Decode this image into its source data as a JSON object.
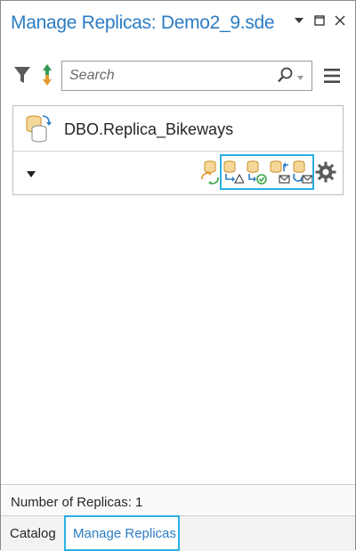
{
  "pane": {
    "title": "Manage Replicas: Demo2_9.sde",
    "controls": [
      "dropdown-arrow-icon",
      "restore-icon",
      "close-icon"
    ]
  },
  "toolbar": {
    "filter_icon": "filter-icon",
    "sort_icon": "sort-icon",
    "search_placeholder": "Search",
    "search_icon": "search-icon",
    "menu_icon": "menu-icon"
  },
  "replica": {
    "name": "DBO.Replica_Bikeways",
    "icon": "replica-icon",
    "actions": [
      "synchronize-changes-icon",
      "export-data-changes-icon",
      "import-message-icon",
      "re-export-unacknowledged-messages-icon",
      "export-acknowledgment-message-icon"
    ],
    "settings_icon": "gear-icon"
  },
  "status": {
    "text": "Number of Replicas: 1"
  },
  "tabs": [
    {
      "label": "Catalog",
      "active": false
    },
    {
      "label": "Manage Replicas",
      "active": true
    }
  ],
  "colors": {
    "title": "#2b7cc4",
    "highlight": "#2bb0e3",
    "database": "#e8b04a",
    "arrow": "#2b7cc4",
    "check": "#3aa84a"
  }
}
